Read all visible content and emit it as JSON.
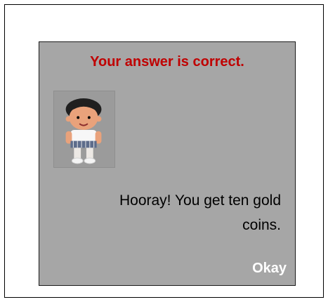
{
  "dialog": {
    "title": "Your answer is correct.",
    "message": "Hooray! You get ten gold coins.",
    "okay_label": "Okay",
    "avatar_icon": "cartoon-boy-icon"
  },
  "colors": {
    "dialog_background": "#a6a6a6",
    "title": "#c00000",
    "message": "#000000",
    "button_text": "#ffffff"
  }
}
